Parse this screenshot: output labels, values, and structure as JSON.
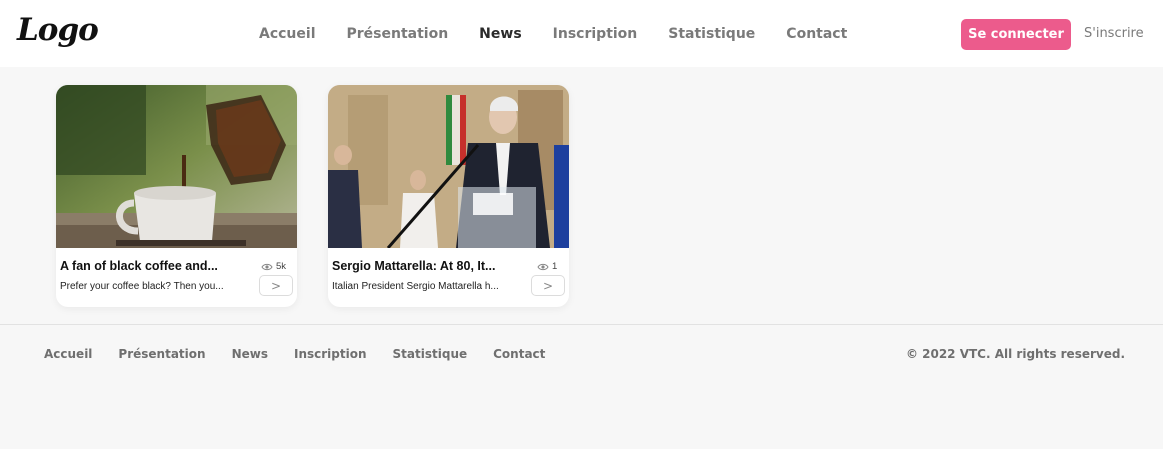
{
  "header": {
    "logo": "Logo",
    "nav": [
      {
        "label": "Accueil",
        "active": false
      },
      {
        "label": "Présentation",
        "active": false
      },
      {
        "label": "News",
        "active": true
      },
      {
        "label": "Inscription",
        "active": false
      },
      {
        "label": "Statistique",
        "active": false
      },
      {
        "label": "Contact",
        "active": false
      }
    ],
    "login_label": "Se connecter",
    "signup_label": "S'inscrire",
    "accent_color": "#ec5b8c"
  },
  "cards": [
    {
      "title": "A fan of black coffee and...",
      "description": "Prefer your coffee black? Then you...",
      "views": "5k",
      "view_icon": "eye-icon",
      "arrow_icon": "chevron-right-icon",
      "arrow": ">"
    },
    {
      "title": "Sergio Mattarella: At 80, It...",
      "description": "Italian President Sergio Mattarella h...",
      "views": "1",
      "view_icon": "eye-icon",
      "arrow_icon": "chevron-right-icon",
      "arrow": ">"
    }
  ],
  "footer": {
    "nav": [
      "Accueil",
      "Présentation",
      "News",
      "Inscription",
      "Statistique",
      "Contact"
    ],
    "copyright": "© 2022 VTC. All rights reserved."
  }
}
